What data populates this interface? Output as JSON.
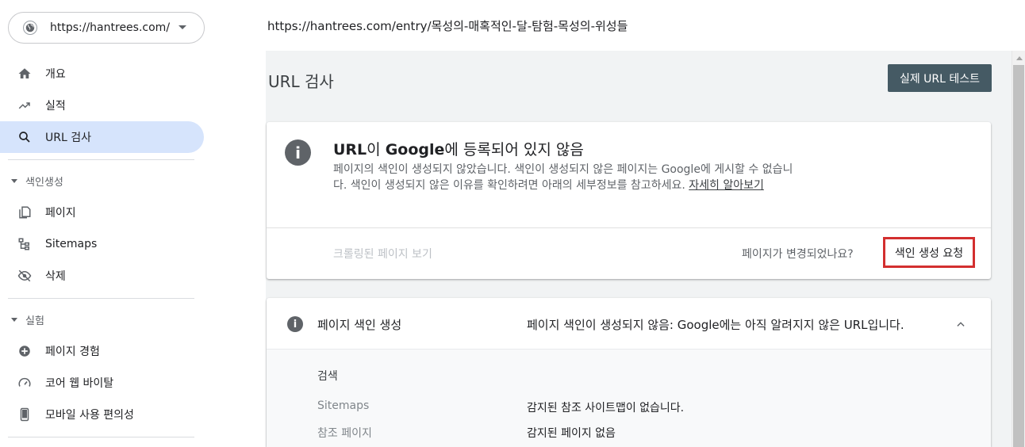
{
  "property": {
    "url": "https://hantrees.com/"
  },
  "sidebar": {
    "items": [
      {
        "label": "개요",
        "icon": "home-icon"
      },
      {
        "label": "실적",
        "icon": "trending-up-icon"
      },
      {
        "label": "URL 검사",
        "icon": "search-icon",
        "active": true
      }
    ],
    "index_section": {
      "title": "색인생성",
      "items": [
        {
          "label": "페이지",
          "icon": "pages-icon"
        },
        {
          "label": "Sitemaps",
          "icon": "sitemap-icon"
        },
        {
          "label": "삭제",
          "icon": "eye-off-icon"
        }
      ]
    },
    "exp_section": {
      "title": "실험",
      "items": [
        {
          "label": "페이지 경험",
          "icon": "plus-circle-icon"
        },
        {
          "label": "코어 웹 바이탈",
          "icon": "speedometer-icon"
        },
        {
          "label": "모바일 사용 편의성",
          "icon": "smartphone-icon"
        }
      ]
    }
  },
  "topbar": {
    "inspected_url": "https://hantrees.com/entry/목성의-매혹적인-달-탐험-목성의-위성들"
  },
  "main": {
    "title": "URL 검사",
    "live_test_label": "실제 URL 테스트",
    "status_card": {
      "headline_part1": "URL",
      "headline_part2": "이 ",
      "headline_part3": "Google",
      "headline_part4": "에 등록되어 있지 않음",
      "description": "페이지의 색인이 생성되지 않았습니다. 색인이 생성되지 않은 페이지는 Google에 게시할 수 없습니다. 색인이 생성되지 않은 이유를 확인하려면 아래의 세부정보를 참고하세요.",
      "learn_more": "자세히 알아보기",
      "crawled_page_label": "크롤링된 페이지 보기",
      "changed_question": "페이지가 변경되었나요?",
      "request_index_label": "색인 생성 요청"
    },
    "indexing_card": {
      "title": "페이지 색인 생성",
      "summary": "페이지 색인이 생성되지 않음: Google에는 아직 알려지지 않은 URL입니다.",
      "group_title": "검색",
      "rows": [
        {
          "key": "Sitemaps",
          "value": "감지된 참조 사이트맵이 없습니다."
        },
        {
          "key": "참조 페이지",
          "value": "감지된 페이지 없음"
        }
      ]
    }
  },
  "colors": {
    "accent": "#d6e4fc",
    "button": "#455a64",
    "highlight": "#d32f2f"
  }
}
